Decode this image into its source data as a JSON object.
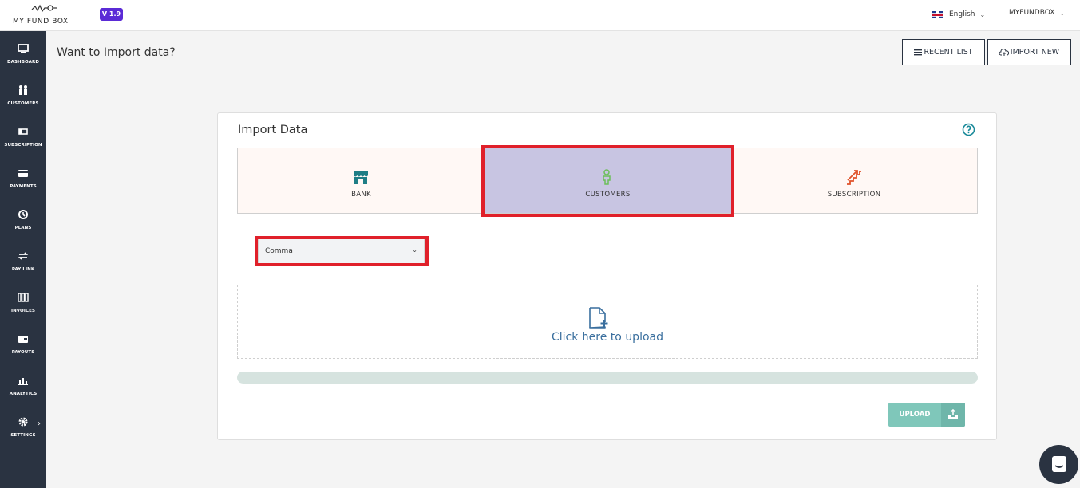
{
  "app": {
    "logo_text": "MY FUND BOX",
    "version": "V 1.9"
  },
  "topbar": {
    "language": "English",
    "user": "MYFUNDBOX"
  },
  "sidebar": {
    "items": [
      {
        "label": "DASHBOARD",
        "icon": "monitor-icon"
      },
      {
        "label": "CUSTOMERS",
        "icon": "users-icon"
      },
      {
        "label": "SUBSCRIPTION",
        "icon": "subscription-icon"
      },
      {
        "label": "PAYMENTS",
        "icon": "card-icon"
      },
      {
        "label": "PLANS",
        "icon": "plan-icon"
      },
      {
        "label": "PAY LINK",
        "icon": "swap-icon"
      },
      {
        "label": "INVOICES",
        "icon": "invoice-icon"
      },
      {
        "label": "PAYOUTS",
        "icon": "wallet-icon"
      },
      {
        "label": "ANALYTICS",
        "icon": "chart-icon"
      },
      {
        "label": "SETTINGS",
        "icon": "gear-icon"
      }
    ]
  },
  "header": {
    "title": "Want to Import data?",
    "recent_list": "RECENT LIST",
    "import_new": "IMPORT NEW"
  },
  "import_card": {
    "title": "Import Data",
    "types": [
      {
        "label": "BANK",
        "icon": "bank-icon",
        "selected": false
      },
      {
        "label": "CUSTOMERS",
        "icon": "customer-icon",
        "selected": true
      },
      {
        "label": "SUBSCRIPTION",
        "icon": "stairs-icon",
        "selected": false
      }
    ],
    "delimiter_selected": "Comma",
    "dropzone_text": "Click here to upload",
    "upload_label": "UPLOAD",
    "progress": 0
  },
  "colors": {
    "sidebar_bg": "#2a3341",
    "accent_purple": "#5b2bd6",
    "selected_bg": "#c8c5e2",
    "highlight_red": "#e0202a",
    "upload_green": "#7fc7ba",
    "link_blue": "#3a6f9e",
    "help_teal": "#1a8a9a"
  }
}
